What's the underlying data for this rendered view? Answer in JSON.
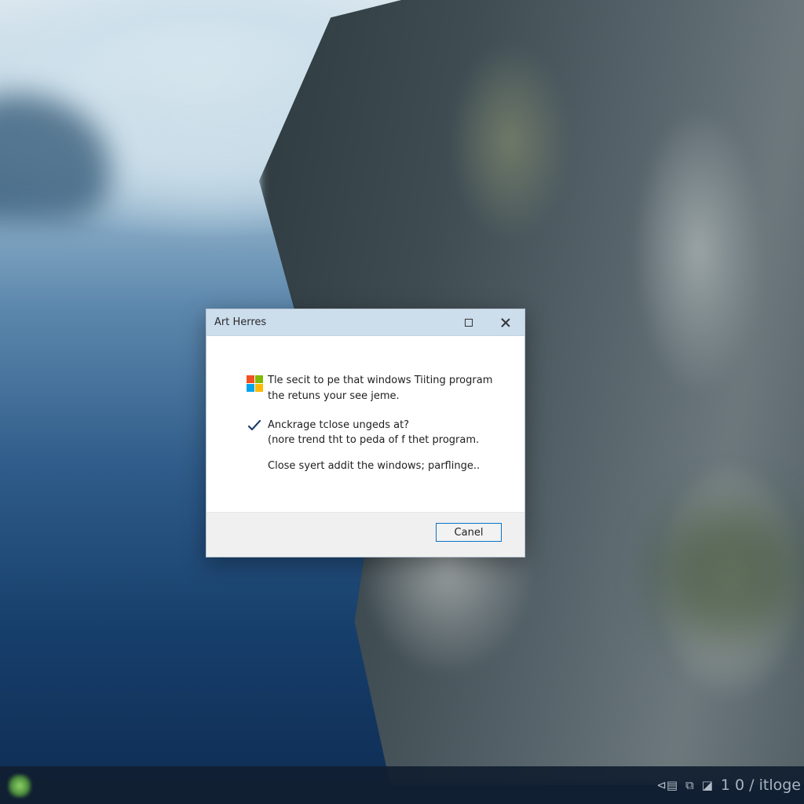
{
  "dialog": {
    "title": "Art Herres",
    "message_line1": "Tle secit to pe that windows Tiiting program",
    "message_line2": "the retuns your see jeme.",
    "option_line1": "Anckrage tclose ungeds at?",
    "option_line2": "(nore trend tht to peda of f thet program.",
    "note": "Close syert addit the windows; parflinge..",
    "cancel_label": "Canel"
  },
  "taskbar": {
    "tray_text": "1 0 / itloge"
  },
  "colors": {
    "titlebar": "#ccddec",
    "button_border": "#0a72c8",
    "footer": "#f0f0f0"
  },
  "icons": [
    "windows-logo-icon",
    "checkmark-icon",
    "maximize-icon",
    "close-icon",
    "start-icon",
    "tray-icons"
  ]
}
